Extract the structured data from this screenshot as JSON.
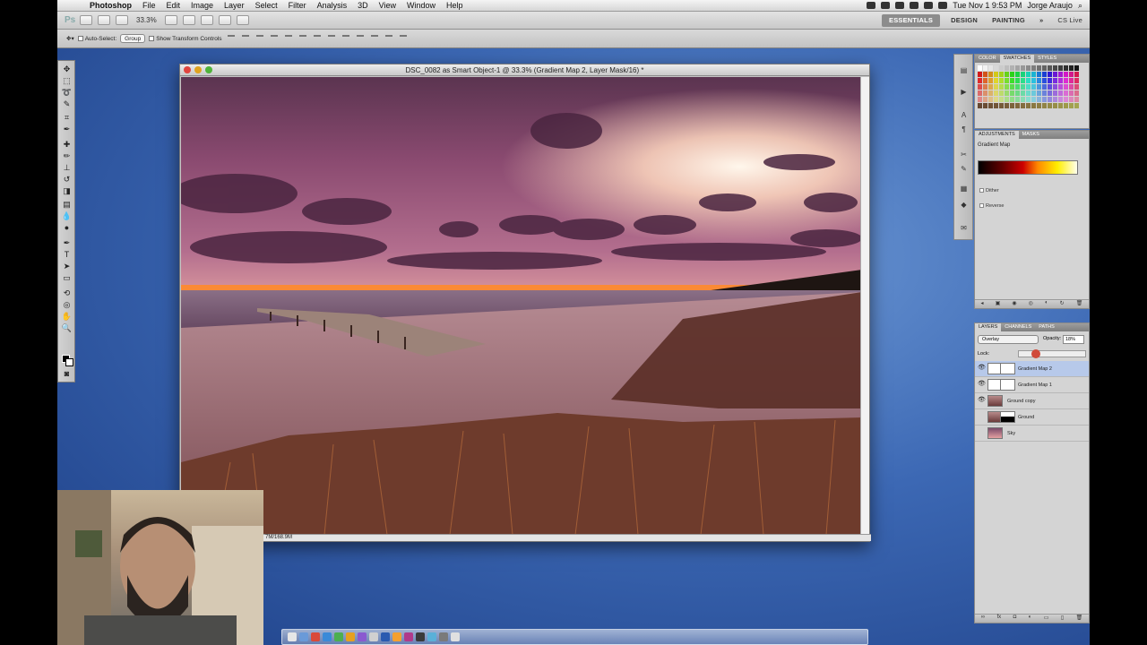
{
  "menubar": {
    "app_name": "Photoshop",
    "items": [
      "File",
      "Edit",
      "Image",
      "Layer",
      "Select",
      "Filter",
      "Analysis",
      "3D",
      "View",
      "Window",
      "Help"
    ],
    "clock": "Tue Nov 1  9:53 PM",
    "user": "Jorge Araujo"
  },
  "appbar": {
    "logo": "Ps",
    "zoom": "33.3%",
    "workspaces": [
      "ESSENTIALS",
      "DESIGN",
      "PAINTING"
    ],
    "more": "»",
    "cs_live": "CS Live"
  },
  "options": {
    "auto_select_label": "Auto-Select:",
    "auto_select_value": "Group",
    "show_transform_label": "Show Transform Controls"
  },
  "document": {
    "title": "DSC_0082 as Smart Object-1 @ 33.3% (Gradient Map 2, Layer Mask/16) *",
    "status": "7M/168.9M"
  },
  "panels": {
    "color_tabs": [
      "COLOR",
      "SWATCHES",
      "STYLES"
    ],
    "active_color_tab": "SWATCHES",
    "adjust_tabs": [
      "ADJUSTMENTS",
      "MASKS"
    ],
    "adjust_title": "Gradient Map",
    "dither_label": "Dither",
    "reverse_label": "Reverse",
    "layer_tabs": [
      "LAYERS",
      "CHANNELS",
      "PATHS"
    ],
    "blend_mode": "Overlay",
    "opacity_label": "Opacity:",
    "opacity_value": "18%",
    "lock_label": "Lock:",
    "layers": [
      {
        "name": "Gradient Map 2",
        "selected": true
      },
      {
        "name": "Gradient Map 1",
        "selected": false
      },
      {
        "name": "Ground copy",
        "selected": false
      },
      {
        "name": "Ground",
        "selected": false
      },
      {
        "name": "Sky",
        "selected": false
      }
    ]
  },
  "colors": {
    "accent_selection": "#b7c9ea",
    "desktop_blue": "#3c68b4"
  }
}
